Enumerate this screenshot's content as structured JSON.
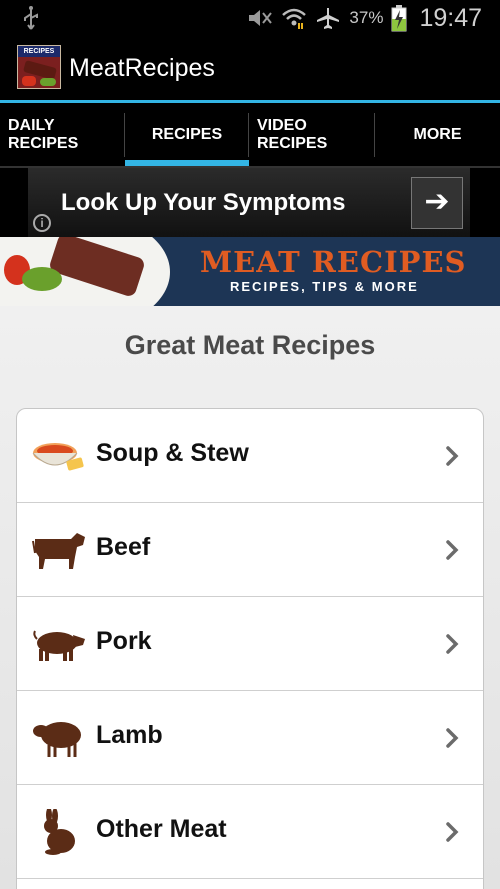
{
  "status_bar": {
    "battery_percent": "37%",
    "time": "19:47",
    "icons": [
      "usb-icon",
      "mute-icon",
      "wifi-icon",
      "airplane-icon",
      "battery-charging-icon"
    ]
  },
  "action_bar": {
    "logo_text": "RECIPES",
    "title": "MeatRecipes"
  },
  "tabs": [
    {
      "line1": "DAILY",
      "line2": "RECIPES",
      "active": false
    },
    {
      "line1": "RECIPES",
      "line2": "",
      "active": true
    },
    {
      "line1": "VIDEO",
      "line2": "RECIPES",
      "active": false
    },
    {
      "line1": "MORE",
      "line2": "",
      "active": false
    }
  ],
  "ad": {
    "text": "Look Up Your Symptoms",
    "info": "i"
  },
  "banner": {
    "title": "MEAT RECIPES",
    "subtitle": "RECIPES, TIPS & MORE"
  },
  "main": {
    "title": "Great Meat Recipes",
    "categories": [
      {
        "label": "Soup & Stew",
        "icon": "soup-bowl-icon"
      },
      {
        "label": "Beef",
        "icon": "cow-icon"
      },
      {
        "label": "Pork",
        "icon": "pig-icon"
      },
      {
        "label": "Lamb",
        "icon": "sheep-icon"
      },
      {
        "label": "Other Meat",
        "icon": "rabbit-icon"
      }
    ]
  },
  "colors": {
    "accent": "#33b5e5",
    "banner_title": "#e05c22",
    "animal": "#5b2c16"
  }
}
